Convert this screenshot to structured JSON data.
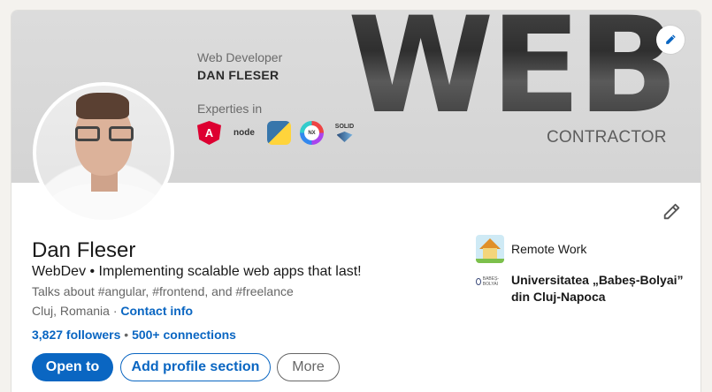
{
  "banner": {
    "role": "Web Developer",
    "name": "DAN FLESER",
    "expertise_label": "Experties in",
    "big_text": "WEB",
    "subtitle": "CONTRACTOR",
    "tech": [
      "angular",
      "node",
      "python",
      "nx",
      "solid"
    ],
    "tech_node_label": "node",
    "tech_nx_label": "NX",
    "tech_solid_label": "SOLID",
    "tech_angular_label": "A"
  },
  "profile": {
    "name": "Dan Fleser",
    "headline": "WebDev • Implementing scalable web apps that last!",
    "talks_about": "Talks about #angular, #frontend, and #freelance",
    "location": "Cluj, Romania",
    "location_sep": "·",
    "contact_info": "Contact info",
    "followers": "3,827 followers",
    "network_sep": "•",
    "connections": "500+ connections"
  },
  "actions": {
    "open_to": "Open to",
    "add_section": "Add profile section",
    "more": "More"
  },
  "sidebar": {
    "work": "Remote Work",
    "education_line1": "Universitatea „Babeș-Bolyai”",
    "education_line2": "din Cluj-Napoca",
    "uni_logo_text": "BABEȘ-BOLYAI"
  },
  "colors": {
    "accent": "#0a66c2",
    "background": "#f4f2ee"
  }
}
